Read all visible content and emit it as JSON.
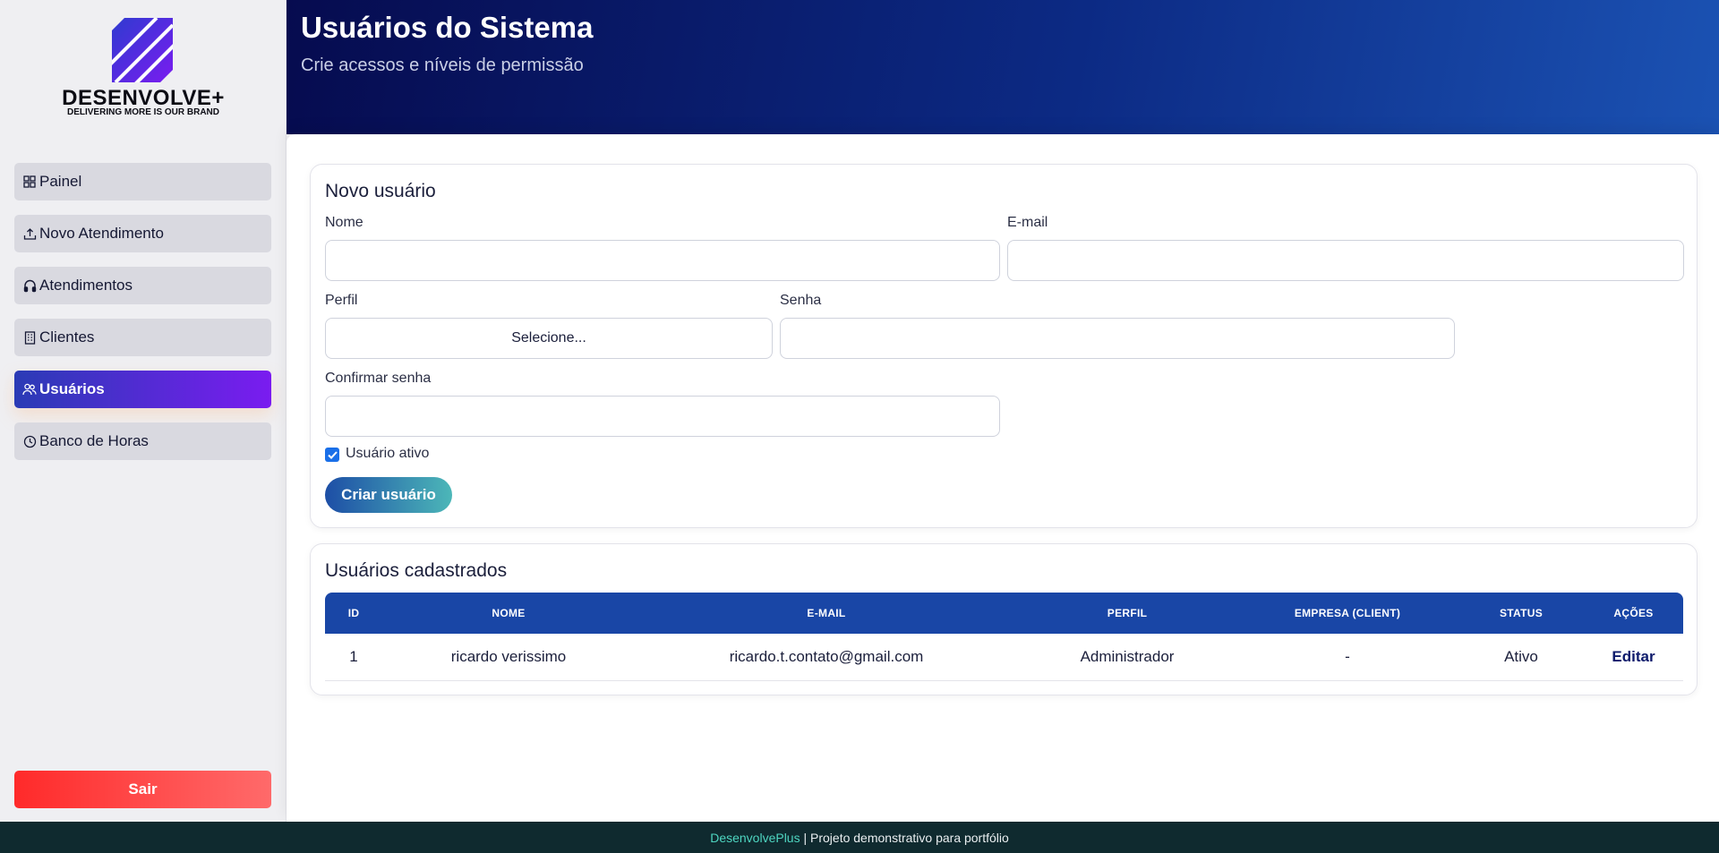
{
  "brand": {
    "name": "DESENVOLVE+",
    "tagline": "DELIVERING MORE IS OUR BRAND"
  },
  "sidebar": {
    "items": [
      {
        "label": "Painel",
        "icon": "grid-icon"
      },
      {
        "label": "Novo Atendimento",
        "icon": "upload-icon"
      },
      {
        "label": "Atendimentos",
        "icon": "headphones-icon"
      },
      {
        "label": "Clientes",
        "icon": "building-icon"
      },
      {
        "label": "Usuários",
        "icon": "users-icon",
        "active": true
      },
      {
        "label": "Banco de Horas",
        "icon": "clock-icon"
      }
    ],
    "logout_label": "Sair"
  },
  "header": {
    "title": "Usuários do Sistema",
    "subtitle": "Crie acessos e níveis de permissão"
  },
  "form": {
    "title": "Novo usuário",
    "name_label": "Nome",
    "name_value": "",
    "email_label": "E-mail",
    "email_value": "",
    "profile_label": "Perfil",
    "profile_value": "Selecione...",
    "password_label": "Senha",
    "password_value": "",
    "confirm_label": "Confirmar senha",
    "confirm_value": "",
    "active_label": "Usuário ativo",
    "active_checked": true,
    "submit_label": "Criar usuário"
  },
  "list": {
    "title": "Usuários cadastrados",
    "columns": [
      "ID",
      "NOME",
      "E-MAIL",
      "PERFIL",
      "EMPRESA (CLIENT)",
      "STATUS",
      "AÇÕES"
    ],
    "rows": [
      {
        "id": "1",
        "name": "ricardo verissimo",
        "email": "ricardo.t.contato@gmail.com",
        "profile": "Administrador",
        "company": "-",
        "status": "Ativo",
        "action": "Editar"
      }
    ]
  },
  "footer": {
    "brand": "DesenvolvePlus",
    "text": " | Projeto demonstrativo para portfólio"
  },
  "colors": {
    "header_start": "#060b4f",
    "header_end": "#1b52b3",
    "active_nav": "#7a1cf0",
    "logout": "#ff2a2a",
    "table_header": "#1946a6"
  }
}
